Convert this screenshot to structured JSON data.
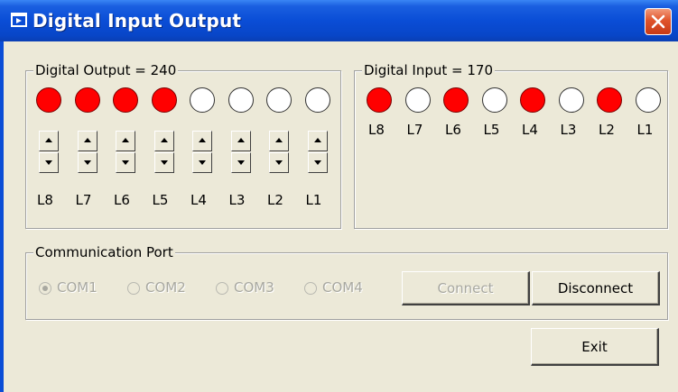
{
  "window": {
    "title": "Digital Input Output",
    "title_icon": "app-window-icon",
    "close_icon": "close-icon"
  },
  "digital_output": {
    "legend": "Digital Output = 240",
    "leds": [
      true,
      true,
      true,
      true,
      false,
      false,
      false,
      false
    ],
    "labels": [
      "L8",
      "L7",
      "L6",
      "L5",
      "L4",
      "L3",
      "L2",
      "L1"
    ]
  },
  "digital_input": {
    "legend": "Digital Input = 170",
    "leds": [
      true,
      false,
      true,
      false,
      true,
      false,
      true,
      false
    ],
    "labels": [
      "L8",
      "L7",
      "L6",
      "L5",
      "L4",
      "L3",
      "L2",
      "L1"
    ]
  },
  "comm": {
    "legend": "Communication Port",
    "ports": [
      "COM1",
      "COM2",
      "COM3",
      "COM4"
    ],
    "selected": "COM1",
    "connect_label": "Connect",
    "disconnect_label": "Disconnect"
  },
  "exit_label": "Exit",
  "colors": {
    "led_on": "#ff0000",
    "titlebar": "#0a4dd6",
    "close": "#e0542b"
  }
}
